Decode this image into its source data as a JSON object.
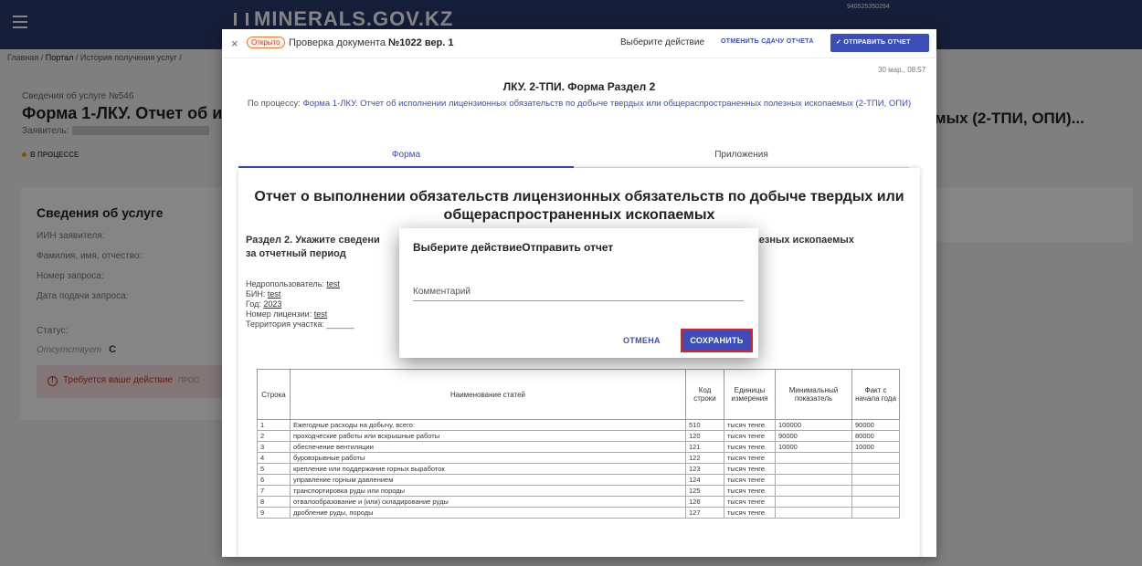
{
  "header": {
    "logo": "MINERALS.GOV.KZ",
    "user_id": "940525350294"
  },
  "breadcrumb": {
    "home": "Главная",
    "portal": "Портал",
    "history": "История получения услуг /"
  },
  "service": {
    "number": "Сведения об услуге №546",
    "title": "Форма 1-ЛКУ. Отчет об испо",
    "title_tail": "мых (2-ТПИ, ОПИ)...",
    "applicant_label": "Заявитель:",
    "status_pill": "В ПРОЦЕССЕ"
  },
  "card": {
    "title": "Сведения об услуге",
    "iin": "ИИН заявителя:",
    "fio": "Фамилия, имя, отчество:",
    "request_no": "Номер запроса:",
    "request_date": "Дата подачи запроса:",
    "status_label": "Статус:",
    "status_value": "Отсутствует",
    "alert": "Требуется ваше действие",
    "alert_tail": "ПРОС"
  },
  "document": {
    "badge": "Открыто",
    "title_prefix": "Проверка документа",
    "title_num": "№1022 вер. 1",
    "choose_action": "Выберите действие",
    "cancel_submit": "ОТМЕНИТЬ СДАЧУ ОТЧЕТА",
    "send_report": "✓ ОТПРАВИТЬ ОТЧЕТ",
    "date": "30 мар., 08:57",
    "form_heading": "ЛКУ. 2-ТПИ. Форма Раздел 2",
    "process_label": "По процессу:",
    "process_link": "Форма 1-ЛКУ. Отчет об исполнении лицензионных обязательств по добыче твердых или общераспространенных полезных ископаемых (2-ТПИ, ОПИ)",
    "tab_form": "Форма",
    "tab_apps": "Приложения",
    "paper_title_1": "Отчет о выполнении обязательств лицензионных обязательств по добыче твердых или",
    "paper_title_2": "общераспространенных ископаемых",
    "section_part1": "Раздел 2. Укажите сведени",
    "section_part2": "полезных ископаемых",
    "section_line2": "за отчетный период",
    "subsoil_user": "Недропользователь:",
    "subsoil_val": "test",
    "bin": "БИН:",
    "bin_val": "test",
    "year": "Год:",
    "year_val": "2023",
    "license": "Номер лицензии:",
    "license_val": "test",
    "territory": "Территория участка:",
    "territory_val": "______"
  },
  "table": {
    "headers": [
      "Строка",
      "Наименование статей",
      "Код строки",
      "Единицы измерения",
      "Минимальный показатель",
      "Факт с начала года"
    ],
    "rows": [
      [
        "1",
        "Ежегодные расходы на добычу, всего:",
        "510",
        "тысяч тенге",
        "100000",
        "90000"
      ],
      [
        "2",
        "проходческие работы или вскрышные работы",
        "120",
        "тысяч тенге",
        "90000",
        "80000"
      ],
      [
        "3",
        "обеспечение вентиляции",
        "121",
        "тысяч тенге",
        "10000",
        "10000"
      ],
      [
        "4",
        "буровзрывные работы",
        "122",
        "тысяч тенге",
        "",
        ""
      ],
      [
        "5",
        "крепление или поддержание горных выработок",
        "123",
        "тысяч тенге",
        "",
        ""
      ],
      [
        "6",
        "управление горным давлением",
        "124",
        "тысяч тенге",
        "",
        ""
      ],
      [
        "7",
        "транспортировка руды или породы",
        "125",
        "тысяч тенге",
        "",
        ""
      ],
      [
        "8",
        "отвалообразование и (или) складирование руды",
        "126",
        "тысяч тенге",
        "",
        ""
      ],
      [
        "9",
        "дробление руды, породы",
        "127",
        "тысяч тенге",
        "",
        ""
      ]
    ]
  },
  "modal": {
    "title": "Выберите действиеОтправить отчет",
    "comment_placeholder": "Комментарий",
    "cancel": "ОТМЕНА",
    "save": "СОХРАНИТЬ"
  },
  "colors": {
    "primary": "#3b4db8",
    "header": "#2a3a6d",
    "highlight_border": "#e02020"
  }
}
